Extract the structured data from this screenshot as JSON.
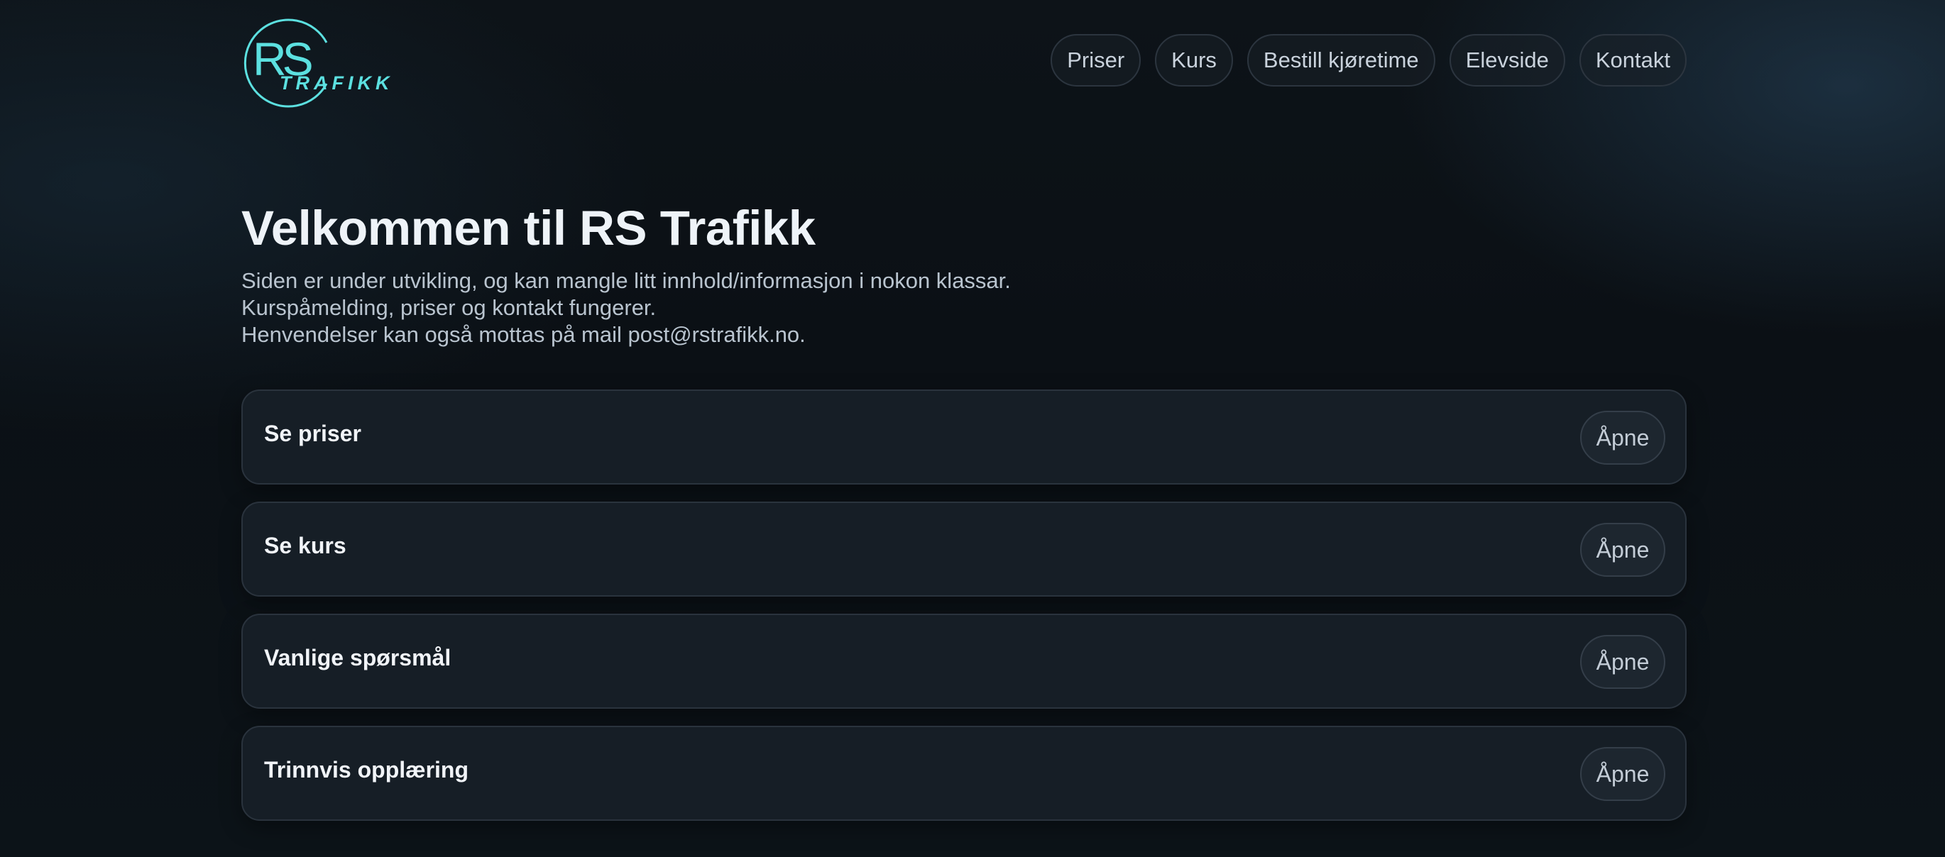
{
  "brand": {
    "logo_letters": "RS",
    "logo_sub": "TRAFIKK",
    "accent": "#5ce0e0"
  },
  "nav": {
    "items": [
      {
        "label": "Priser"
      },
      {
        "label": "Kurs"
      },
      {
        "label": "Bestill kjøretime"
      },
      {
        "label": "Elevside"
      },
      {
        "label": "Kontakt"
      }
    ]
  },
  "hero": {
    "title": "Velkommen til RS Trafikk",
    "lines": [
      "Siden er under utvikling, og kan mangle litt innhold/informasjon i nokon klassar.",
      "Kurspåmelding, priser og kontakt fungerer.",
      "Henvendelser kan også mottas på mail post@rstrafikk.no."
    ]
  },
  "sections": [
    {
      "title": "Se priser",
      "button": "Åpne"
    },
    {
      "title": "Se kurs",
      "button": "Åpne"
    },
    {
      "title": "Vanlige spørsmål",
      "button": "Åpne"
    },
    {
      "title": "Trinnvis opplæring",
      "button": "Åpne"
    }
  ]
}
